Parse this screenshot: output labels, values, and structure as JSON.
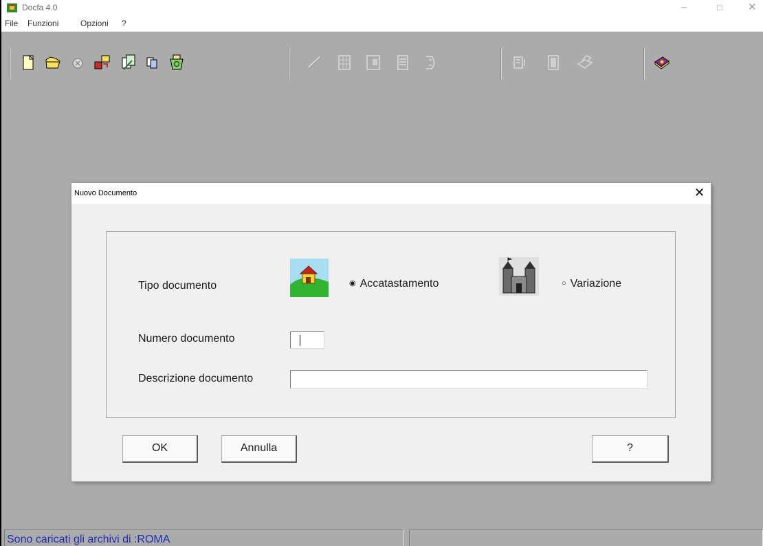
{
  "app": {
    "title": "Docfa 4.0"
  },
  "window_controls": {
    "minimize": "–",
    "maximize": "□",
    "close": "✕"
  },
  "menu": [
    "File",
    "Funzioni",
    "Opzioni",
    "?"
  ],
  "toolbar": {
    "icons": [
      "new-document-icon",
      "open-folder-icon",
      "cancel-circle-icon",
      "import-export-icon",
      "edit-pages-icon",
      "copy-icon",
      "recycle-archive-icon",
      "check-disabled-icon",
      "grid-disabled-icon",
      "layout-disabled-icon",
      "list-disabled-icon",
      "plan-disabled-icon",
      "print-preview-disabled-icon",
      "document-disabled-icon",
      "printer-disabled-icon",
      "help-book-icon"
    ]
  },
  "dialog": {
    "title": "Nuovo Documento",
    "close": "✕",
    "tipo_label": "Tipo documento",
    "options": [
      {
        "label": "Accatastamento",
        "selected": true,
        "icon": "house-hill-icon"
      },
      {
        "label": "Variazione",
        "selected": false,
        "icon": "castle-icon"
      }
    ],
    "radio_on": "◉",
    "radio_off": "○",
    "numero_label": "Numero documento",
    "numero_value": "",
    "descrizione_label": "Descrizione documento",
    "descrizione_value": "",
    "buttons": {
      "ok": "OK",
      "annulla": "Annulla",
      "help": "?"
    }
  },
  "status": {
    "text": "Sono caricati gli archivi di :ROMA"
  }
}
